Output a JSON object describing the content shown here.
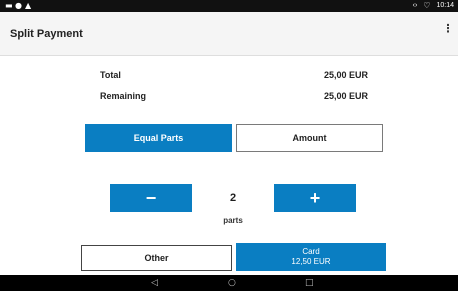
{
  "status_bar": {
    "left_icons": [
      "message-icon",
      "info-icon",
      "warning-icon"
    ],
    "time": "10:14"
  },
  "header": {
    "title": "Split Payment",
    "overflow_icon": "more-vert-icon"
  },
  "summary": {
    "total_label": "Total",
    "total_value": "25,00 EUR",
    "remaining_label": "Remaining",
    "remaining_value": "25,00 EUR"
  },
  "mode_tabs": {
    "equal_parts": "Equal Parts",
    "amount": "Amount",
    "selected": "Equal Parts"
  },
  "stepper": {
    "minus": "−",
    "value": "2",
    "plus": "+",
    "unit_label": "parts"
  },
  "actions": {
    "other_label": "Other",
    "card_label": "Card",
    "card_amount": "12,50 EUR"
  },
  "nav_bar": {
    "back_icon": "back-triangle-icon",
    "home_icon": "home-circle-icon",
    "recents_icon": "recents-square-icon"
  },
  "colors": {
    "accent": "#0a7ec2",
    "status_bar": "#111111",
    "app_bar": "#f5f5f5"
  }
}
